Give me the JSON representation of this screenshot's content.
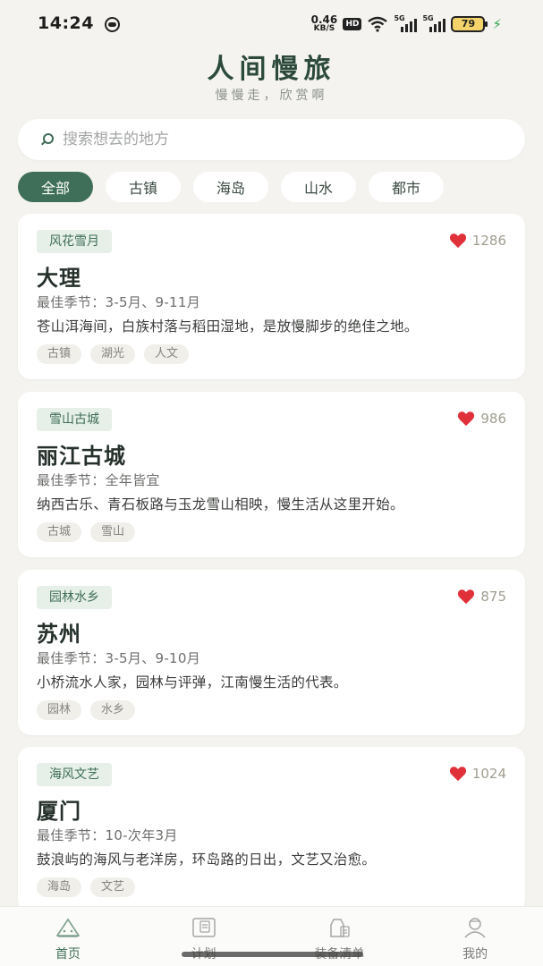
{
  "status_bar": {
    "time": "14:24",
    "net_speed_value": "0.46",
    "net_speed_unit": "KB/S",
    "hd": "HD",
    "signal_1": "5G",
    "signal_2": "5G",
    "battery": "79"
  },
  "header": {
    "title": "人间慢旅",
    "subtitle": "慢慢走，欣赏啊"
  },
  "search": {
    "placeholder": "搜索想去的地方"
  },
  "filters": [
    {
      "label": "全部",
      "active": true
    },
    {
      "label": "古镇",
      "active": false
    },
    {
      "label": "海岛",
      "active": false
    },
    {
      "label": "山水",
      "active": false
    },
    {
      "label": "都市",
      "active": false
    }
  ],
  "cards": [
    {
      "badge": "风花雪月",
      "likes": "1286",
      "title": "大理",
      "season": "最佳季节：3-5月、9-11月",
      "description": "苍山洱海间，白族村落与稻田湿地，是放慢脚步的绝佳之地。",
      "tags": [
        "古镇",
        "湖光",
        "人文"
      ]
    },
    {
      "badge": "雪山古城",
      "likes": "986",
      "title": "丽江古城",
      "season": "最佳季节：全年皆宜",
      "description": "纳西古乐、青石板路与玉龙雪山相映，慢生活从这里开始。",
      "tags": [
        "古城",
        "雪山"
      ]
    },
    {
      "badge": "园林水乡",
      "likes": "875",
      "title": "苏州",
      "season": "最佳季节：3-5月、9-10月",
      "description": "小桥流水人家，园林与评弹，江南慢生活的代表。",
      "tags": [
        "园林",
        "水乡"
      ]
    },
    {
      "badge": "海风文艺",
      "likes": "1024",
      "title": "厦门",
      "season": "最佳季节：10-次年3月",
      "description": "鼓浪屿的海风与老洋房，环岛路的日出，文艺又治愈。",
      "tags": [
        "海岛",
        "文艺"
      ]
    }
  ],
  "bottom_nav": [
    {
      "label": "首页",
      "icon": "home-mountain-icon",
      "active": true
    },
    {
      "label": "计划",
      "icon": "plan-clipboard-icon",
      "active": false
    },
    {
      "label": "装备清单",
      "icon": "gear-checklist-icon",
      "active": false
    },
    {
      "label": "我的",
      "icon": "profile-person-icon",
      "active": false
    }
  ],
  "colors": {
    "accent": "#3f6f58",
    "background": "#f4f3ef",
    "heart": "#e0303a"
  }
}
